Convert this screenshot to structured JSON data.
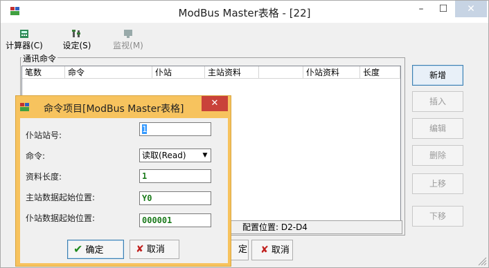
{
  "window": {
    "title": "ModBus Master表格 - [22]",
    "icons": {
      "app": "app-icon",
      "minimize": "minimize-icon",
      "maximize": "maximize-icon",
      "close": "close-icon"
    },
    "min_glyph": "–",
    "max_glyph": "☐",
    "close_glyph": "✕"
  },
  "toolbar": {
    "items": [
      {
        "label": "计算器(C)",
        "icon": "calculator-icon",
        "enabled": true
      },
      {
        "label": "设定(S)",
        "icon": "settings-icon",
        "enabled": true
      },
      {
        "label": "监视(M)",
        "icon": "monitor-icon",
        "enabled": false
      }
    ]
  },
  "group": {
    "label": "通讯命令"
  },
  "table": {
    "columns": [
      "笔数",
      "命令",
      "仆站",
      "主站资料",
      "",
      "仆站资料",
      "长度"
    ],
    "rows": []
  },
  "status": {
    "text": "配置位置: D2-D4"
  },
  "side_buttons": [
    {
      "label": "新增",
      "enabled": true
    },
    {
      "label": "插入",
      "enabled": false
    },
    {
      "label": "编辑",
      "enabled": false
    },
    {
      "label": "删除",
      "enabled": false
    },
    {
      "label": "上移",
      "enabled": false
    },
    {
      "label": "下移",
      "enabled": false
    }
  ],
  "bottom_buttons": {
    "ok": "定",
    "cancel": "取消"
  },
  "dialog": {
    "title": "命令项目[ModBus Master表格]",
    "close_glyph": "✕",
    "fields": {
      "slave_no": {
        "label": "仆站站号:",
        "value": "1"
      },
      "command": {
        "label": "命令:",
        "value": "读取(Read)"
      },
      "length": {
        "label": "资料长度:",
        "value": "1"
      },
      "master_start": {
        "label": "主站数据起始位置:",
        "value": "Y0"
      },
      "slave_start": {
        "label": "仆站数据起始位置:",
        "value": "000001"
      }
    },
    "ok": "确定",
    "cancel": "取消",
    "colors": {
      "frame": "#f7c35e",
      "close": "#c9423a",
      "value_green": "#1b7a1b"
    }
  }
}
